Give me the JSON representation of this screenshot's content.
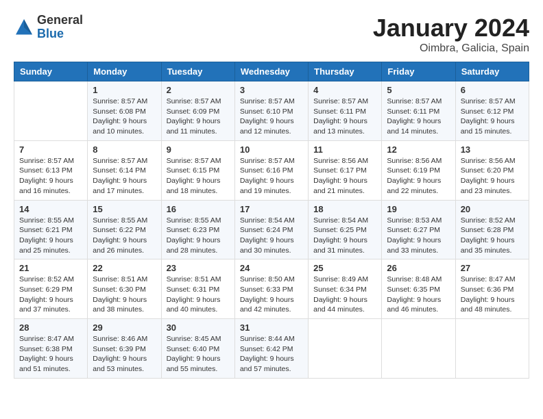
{
  "header": {
    "logo_general": "General",
    "logo_blue": "Blue",
    "month_title": "January 2024",
    "location": "Oimbra, Galicia, Spain"
  },
  "weekdays": [
    "Sunday",
    "Monday",
    "Tuesday",
    "Wednesday",
    "Thursday",
    "Friday",
    "Saturday"
  ],
  "weeks": [
    [
      {
        "day": "",
        "info": ""
      },
      {
        "day": "1",
        "info": "Sunrise: 8:57 AM\nSunset: 6:08 PM\nDaylight: 9 hours\nand 10 minutes."
      },
      {
        "day": "2",
        "info": "Sunrise: 8:57 AM\nSunset: 6:09 PM\nDaylight: 9 hours\nand 11 minutes."
      },
      {
        "day": "3",
        "info": "Sunrise: 8:57 AM\nSunset: 6:10 PM\nDaylight: 9 hours\nand 12 minutes."
      },
      {
        "day": "4",
        "info": "Sunrise: 8:57 AM\nSunset: 6:11 PM\nDaylight: 9 hours\nand 13 minutes."
      },
      {
        "day": "5",
        "info": "Sunrise: 8:57 AM\nSunset: 6:11 PM\nDaylight: 9 hours\nand 14 minutes."
      },
      {
        "day": "6",
        "info": "Sunrise: 8:57 AM\nSunset: 6:12 PM\nDaylight: 9 hours\nand 15 minutes."
      }
    ],
    [
      {
        "day": "7",
        "info": "Sunrise: 8:57 AM\nSunset: 6:13 PM\nDaylight: 9 hours\nand 16 minutes."
      },
      {
        "day": "8",
        "info": "Sunrise: 8:57 AM\nSunset: 6:14 PM\nDaylight: 9 hours\nand 17 minutes."
      },
      {
        "day": "9",
        "info": "Sunrise: 8:57 AM\nSunset: 6:15 PM\nDaylight: 9 hours\nand 18 minutes."
      },
      {
        "day": "10",
        "info": "Sunrise: 8:57 AM\nSunset: 6:16 PM\nDaylight: 9 hours\nand 19 minutes."
      },
      {
        "day": "11",
        "info": "Sunrise: 8:56 AM\nSunset: 6:17 PM\nDaylight: 9 hours\nand 21 minutes."
      },
      {
        "day": "12",
        "info": "Sunrise: 8:56 AM\nSunset: 6:19 PM\nDaylight: 9 hours\nand 22 minutes."
      },
      {
        "day": "13",
        "info": "Sunrise: 8:56 AM\nSunset: 6:20 PM\nDaylight: 9 hours\nand 23 minutes."
      }
    ],
    [
      {
        "day": "14",
        "info": "Sunrise: 8:55 AM\nSunset: 6:21 PM\nDaylight: 9 hours\nand 25 minutes."
      },
      {
        "day": "15",
        "info": "Sunrise: 8:55 AM\nSunset: 6:22 PM\nDaylight: 9 hours\nand 26 minutes."
      },
      {
        "day": "16",
        "info": "Sunrise: 8:55 AM\nSunset: 6:23 PM\nDaylight: 9 hours\nand 28 minutes."
      },
      {
        "day": "17",
        "info": "Sunrise: 8:54 AM\nSunset: 6:24 PM\nDaylight: 9 hours\nand 30 minutes."
      },
      {
        "day": "18",
        "info": "Sunrise: 8:54 AM\nSunset: 6:25 PM\nDaylight: 9 hours\nand 31 minutes."
      },
      {
        "day": "19",
        "info": "Sunrise: 8:53 AM\nSunset: 6:27 PM\nDaylight: 9 hours\nand 33 minutes."
      },
      {
        "day": "20",
        "info": "Sunrise: 8:52 AM\nSunset: 6:28 PM\nDaylight: 9 hours\nand 35 minutes."
      }
    ],
    [
      {
        "day": "21",
        "info": "Sunrise: 8:52 AM\nSunset: 6:29 PM\nDaylight: 9 hours\nand 37 minutes."
      },
      {
        "day": "22",
        "info": "Sunrise: 8:51 AM\nSunset: 6:30 PM\nDaylight: 9 hours\nand 38 minutes."
      },
      {
        "day": "23",
        "info": "Sunrise: 8:51 AM\nSunset: 6:31 PM\nDaylight: 9 hours\nand 40 minutes."
      },
      {
        "day": "24",
        "info": "Sunrise: 8:50 AM\nSunset: 6:33 PM\nDaylight: 9 hours\nand 42 minutes."
      },
      {
        "day": "25",
        "info": "Sunrise: 8:49 AM\nSunset: 6:34 PM\nDaylight: 9 hours\nand 44 minutes."
      },
      {
        "day": "26",
        "info": "Sunrise: 8:48 AM\nSunset: 6:35 PM\nDaylight: 9 hours\nand 46 minutes."
      },
      {
        "day": "27",
        "info": "Sunrise: 8:47 AM\nSunset: 6:36 PM\nDaylight: 9 hours\nand 48 minutes."
      }
    ],
    [
      {
        "day": "28",
        "info": "Sunrise: 8:47 AM\nSunset: 6:38 PM\nDaylight: 9 hours\nand 51 minutes."
      },
      {
        "day": "29",
        "info": "Sunrise: 8:46 AM\nSunset: 6:39 PM\nDaylight: 9 hours\nand 53 minutes."
      },
      {
        "day": "30",
        "info": "Sunrise: 8:45 AM\nSunset: 6:40 PM\nDaylight: 9 hours\nand 55 minutes."
      },
      {
        "day": "31",
        "info": "Sunrise: 8:44 AM\nSunset: 6:42 PM\nDaylight: 9 hours\nand 57 minutes."
      },
      {
        "day": "",
        "info": ""
      },
      {
        "day": "",
        "info": ""
      },
      {
        "day": "",
        "info": ""
      }
    ]
  ]
}
